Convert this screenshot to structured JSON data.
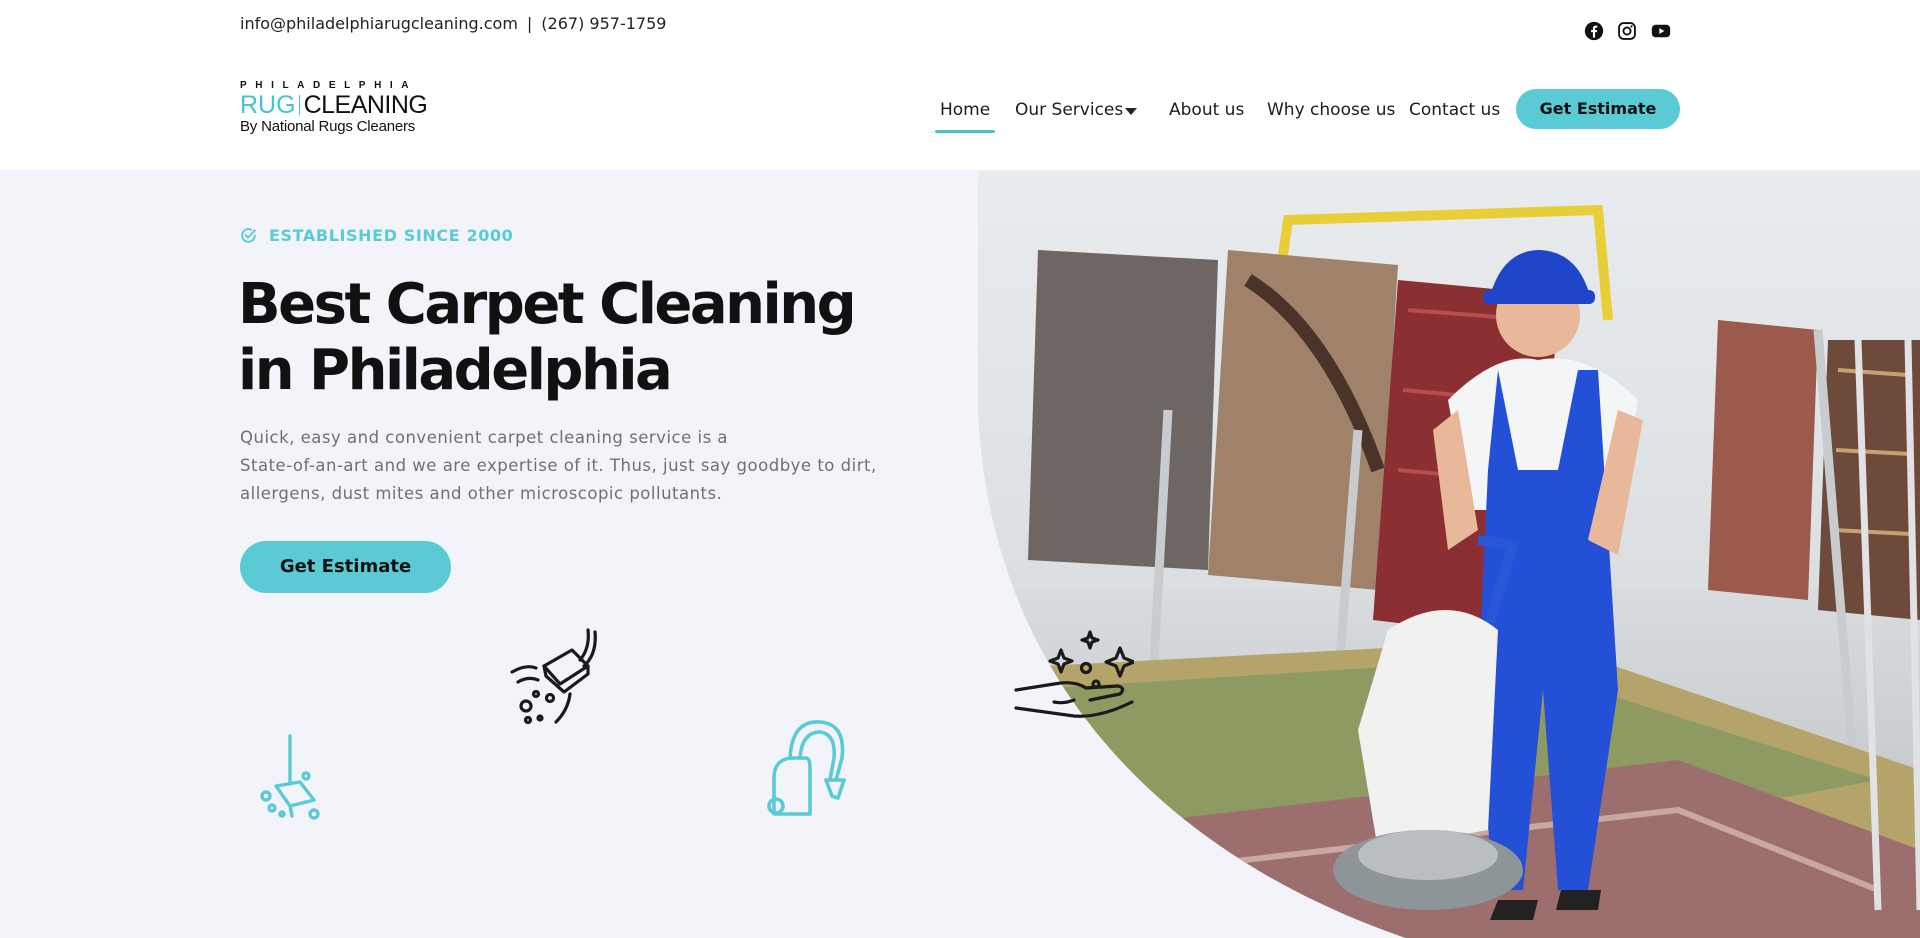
{
  "topbar": {
    "email": "info@philadelphiarugcleaning.com",
    "separator": "|",
    "phone": "(267) 957-1759",
    "social_icons": [
      "facebook-icon",
      "instagram-icon",
      "youtube-icon"
    ]
  },
  "logo": {
    "line1": "PHILADELPHIA",
    "rug": "RUG",
    "cleaning": "CLEANING",
    "line3": "By National Rugs Cleaners"
  },
  "nav": {
    "items": [
      {
        "label": "Home",
        "active": true
      },
      {
        "label": "Our Services",
        "has_dropdown": true
      },
      {
        "label": "About us"
      },
      {
        "label": "Why choose us"
      },
      {
        "label": "Contact us"
      }
    ],
    "cta_label": "Get Estimate"
  },
  "hero": {
    "eyebrow": "ESTABLISHED SINCE 2000",
    "headline_line1": "Best Carpet Cleaning",
    "headline_line2": "in Philadelphia",
    "description_line1": "Quick, easy and convenient carpet cleaning service is a",
    "description_line2": "State-of-an-art and we are expertise of it. Thus, just say goodbye to dirt,",
    "description_line3": "allergens, dust mites and other microscopic pollutants.",
    "cta_label": "Get Estimate"
  },
  "colors": {
    "accent": "#5acbd5",
    "hero_background": "#f3f4f9",
    "heading": "#111111",
    "body_text": "#707070"
  }
}
